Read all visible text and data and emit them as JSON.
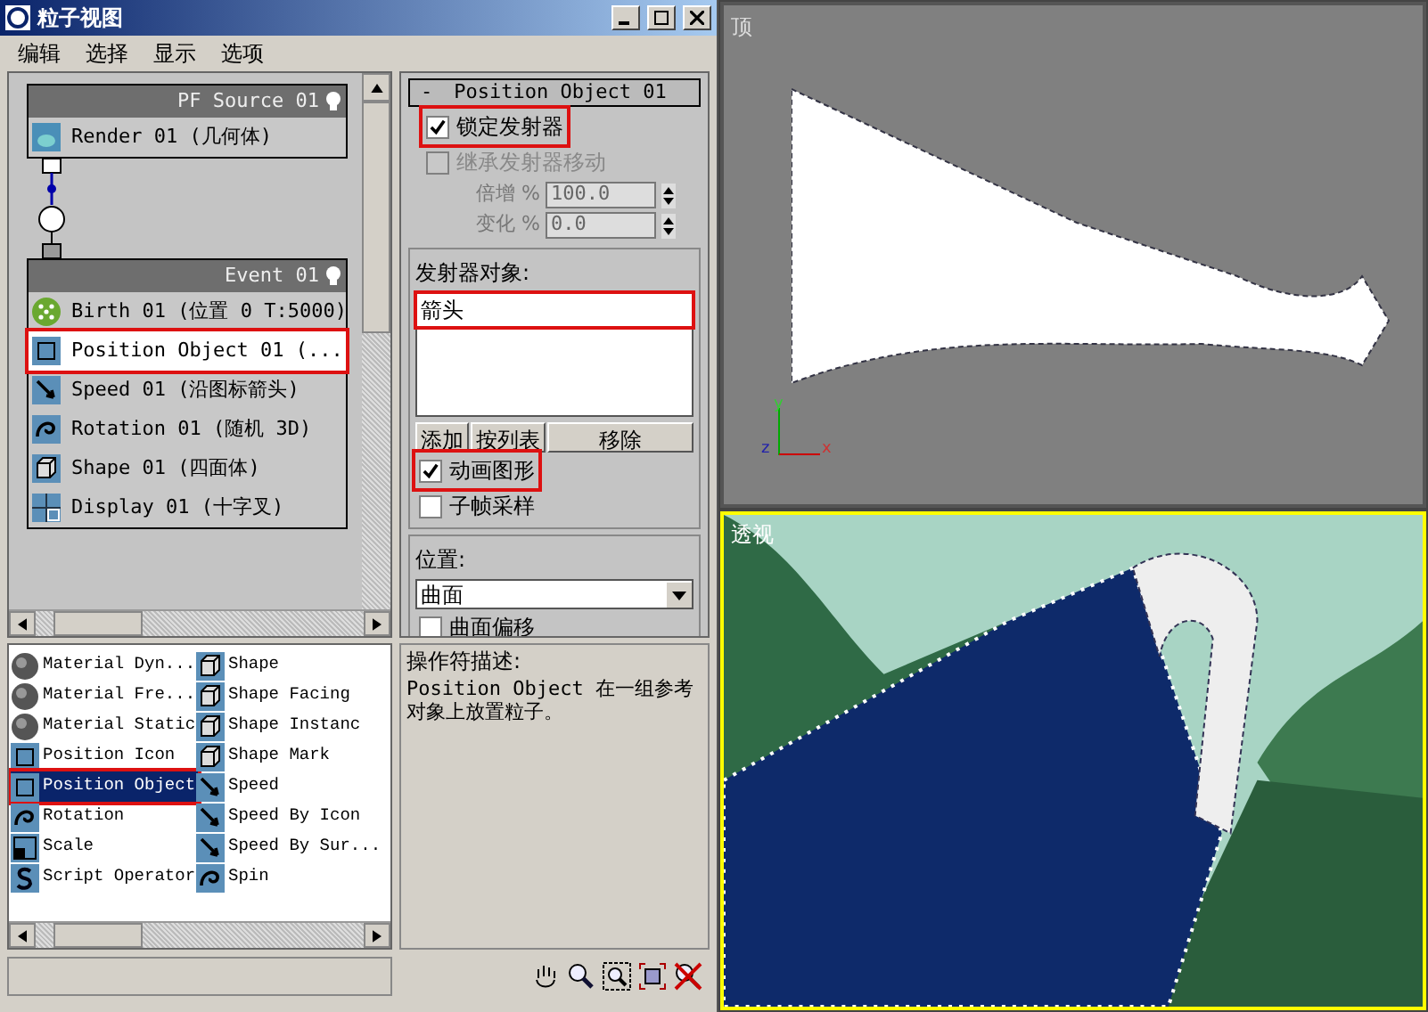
{
  "window": {
    "title": "粒子视图"
  },
  "menu": [
    "编辑",
    "选择",
    "显示",
    "选项"
  ],
  "graph": {
    "source": {
      "title": "PF Source 01",
      "items": [
        {
          "kind": "render",
          "label": "Render 01 (几何体)",
          "highlighted": false
        }
      ]
    },
    "event": {
      "title": "Event 01",
      "items": [
        {
          "kind": "birth",
          "label": "Birth 01 (位置 0 T:5000)",
          "highlighted": false
        },
        {
          "kind": "position",
          "label": "Position Object 01 (...",
          "highlighted": true
        },
        {
          "kind": "speed",
          "label": "Speed 01 (沿图标箭头)",
          "highlighted": false
        },
        {
          "kind": "rotation",
          "label": "Rotation 01 (随机 3D)",
          "highlighted": false
        },
        {
          "kind": "shape",
          "label": "Shape 01 (四面体)",
          "highlighted": false
        },
        {
          "kind": "display",
          "label": "Display 01 (十字叉)",
          "highlighted": false
        }
      ]
    }
  },
  "params": {
    "rollout_toggle": "-",
    "rollout": "Position Object 01",
    "lock": {
      "label": "锁定发射器",
      "checked": true,
      "disabled": false,
      "highlighted": true
    },
    "inherit": {
      "label": "继承发射器移动",
      "checked": false,
      "disabled": true,
      "highlighted": false
    },
    "spinners": [
      {
        "label": "倍增 %",
        "value": "100.0",
        "disabled": true
      },
      {
        "label": "变化 %",
        "value": "0.0",
        "disabled": true
      }
    ],
    "emitters": {
      "title": "发射器对象:",
      "items": [
        {
          "label": "箭头",
          "highlighted": true
        }
      ],
      "buttons": [
        "添加",
        "按列表",
        "移除"
      ]
    },
    "animated": {
      "label": "动画图形",
      "checked": true,
      "disabled": false,
      "highlighted": true
    },
    "subframe": {
      "label": "子帧采样",
      "checked": false,
      "disabled": false,
      "highlighted": false
    },
    "location": {
      "title": "位置:",
      "value": "曲面",
      "offset": {
        "label": "曲面偏移",
        "checked": false,
        "disabled": false,
        "highlighted": false
      }
    }
  },
  "depot": {
    "items": [
      {
        "kind": "material",
        "label": "Material Dyn...",
        "selected": false
      },
      {
        "kind": "material",
        "label": "Material Fre...",
        "selected": false
      },
      {
        "kind": "material",
        "label": "Material Static",
        "selected": false
      },
      {
        "kind": "position",
        "label": "Position Icon",
        "selected": false
      },
      {
        "kind": "position",
        "label": "Position Object",
        "selected": true
      },
      {
        "kind": "rotation",
        "label": "Rotation",
        "selected": false
      },
      {
        "kind": "scale",
        "label": "Scale",
        "selected": false
      },
      {
        "kind": "script",
        "label": "Script Operator",
        "selected": false
      },
      {
        "kind": "shape",
        "label": "Shape",
        "selected": false
      },
      {
        "kind": "shape",
        "label": "Shape Facing",
        "selected": false
      },
      {
        "kind": "shape",
        "label": "Shape Instanc",
        "selected": false
      },
      {
        "kind": "shape",
        "label": "Shape Mark",
        "selected": false
      },
      {
        "kind": "speed",
        "label": "Speed",
        "selected": false
      },
      {
        "kind": "speed",
        "label": "Speed By Icon",
        "selected": false
      },
      {
        "kind": "speed",
        "label": "Speed By Sur...",
        "selected": false
      },
      {
        "kind": "rotation",
        "label": "Spin",
        "selected": false
      }
    ]
  },
  "description": {
    "title": "操作符描述:",
    "text": "Position Object 在一组参考对象上放置粒子。"
  },
  "viewports": [
    {
      "label": "顶",
      "active": false,
      "axes": [
        "y",
        "z",
        "x"
      ]
    },
    {
      "label": "透视",
      "active": true
    }
  ]
}
